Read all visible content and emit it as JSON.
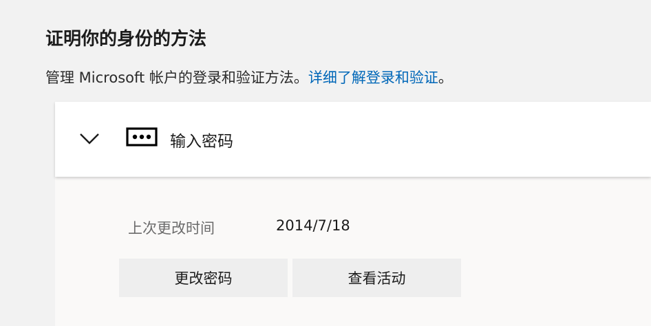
{
  "header": {
    "title": "证明你的身份的方法",
    "subtitle_text": "管理 Microsoft 帐户的登录和验证方法。",
    "subtitle_link": "详细了解登录和验证",
    "subtitle_end": "。"
  },
  "password_method": {
    "label": "输入密码",
    "chevron_icon": "chevron-down-icon",
    "method_icon": "password-dots-icon",
    "expanded": true,
    "last_changed_label": "上次更改时间",
    "last_changed_value": "2014/7/18",
    "buttons": {
      "change_password": "更改密码",
      "view_activity": "查看活动"
    }
  },
  "colors": {
    "link": "#0067b8",
    "background": "#f2f2f2",
    "card_header": "#ffffff",
    "card_body": "#faf9f8",
    "button": "#eeeeee"
  }
}
